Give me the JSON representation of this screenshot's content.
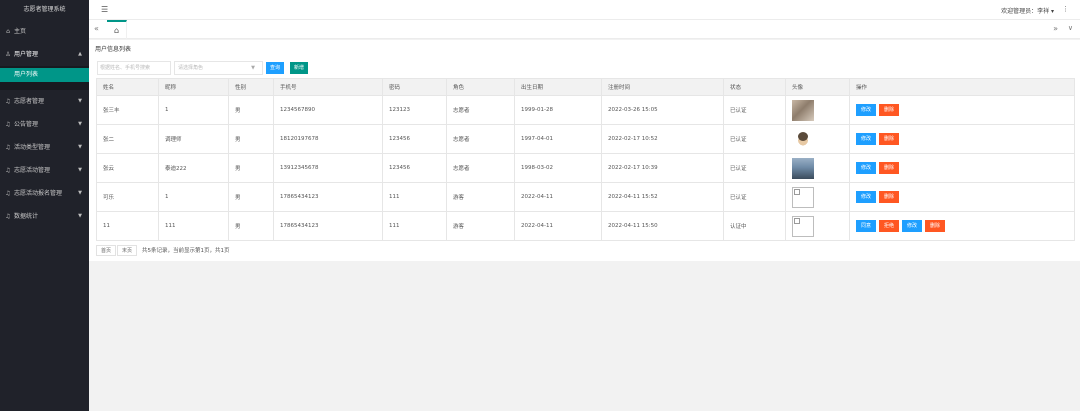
{
  "app": {
    "title": "志愿者管理系统"
  },
  "sidebar": {
    "items": [
      {
        "label": "主页",
        "icon": "home-icon"
      },
      {
        "label": "用户管理",
        "icon": "user-icon",
        "expanded": true,
        "children": [
          {
            "label": "用户列表",
            "active": true
          }
        ]
      },
      {
        "label": "志愿者管理",
        "icon": "bell-icon"
      },
      {
        "label": "公告管理",
        "icon": "bell-icon"
      },
      {
        "label": "活动类型管理",
        "icon": "bell-icon"
      },
      {
        "label": "志愿活动管理",
        "icon": "bell-icon"
      },
      {
        "label": "志愿活动报名管理",
        "icon": "bell-icon"
      },
      {
        "label": "数据统计",
        "icon": "bell-icon"
      }
    ]
  },
  "header": {
    "user_greeting": "欢迎管理员：李祥 ▾",
    "menu_icon": "hamburger-icon",
    "more_icon": "more-vertical-icon"
  },
  "tabs": {
    "prev": "«",
    "home_icon": "home-icon",
    "next": "»",
    "dropdown": "∨"
  },
  "page": {
    "title": "用户信息列表",
    "search_placeholder": "根据姓名、手机号搜索",
    "select_placeholder": "请选择角色",
    "btn_search": "查询",
    "btn_add": "新增"
  },
  "table": {
    "headers": [
      "姓名",
      "昵称",
      "性别",
      "手机号",
      "密码",
      "角色",
      "出生日期",
      "注册时间",
      "状态",
      "头像",
      "操作"
    ],
    "rows": [
      {
        "name": "张三丰",
        "nickname": "1",
        "gender": "男",
        "phone": "1234567890",
        "password": "123123",
        "role": "志愿者",
        "birth": "1999-01-28",
        "reg": "2022-03-26 15:05",
        "status": "已认证",
        "status_type": "ok",
        "avatar": "a1",
        "ops": [
          "修改",
          "删除"
        ]
      },
      {
        "name": "张二",
        "nickname": "调理师",
        "gender": "男",
        "phone": "18120197678",
        "password": "123456",
        "role": "志愿者",
        "birth": "1997-04-01",
        "reg": "2022-02-17 10:52",
        "status": "已认证",
        "status_type": "ok",
        "avatar": "a2",
        "ops": [
          "修改",
          "删除"
        ]
      },
      {
        "name": "张云",
        "nickname": "泰迪222",
        "gender": "男",
        "phone": "13912345678",
        "password": "123456",
        "role": "志愿者",
        "birth": "1998-03-02",
        "reg": "2022-02-17 10:39",
        "status": "已认证",
        "status_type": "ok",
        "avatar": "a3",
        "ops": [
          "修改",
          "删除"
        ]
      },
      {
        "name": "可乐",
        "nickname": "1",
        "gender": "男",
        "phone": "17865434123",
        "password": "111",
        "role": "游客",
        "birth": "2022-04-11",
        "reg": "2022-04-11 15:52",
        "status": "已认证",
        "status_type": "ok",
        "avatar": "broken",
        "ops": [
          "修改",
          "删除"
        ]
      },
      {
        "name": "11",
        "nickname": "111",
        "gender": "男",
        "phone": "17865434123",
        "password": "111",
        "role": "游客",
        "birth": "2022-04-11",
        "reg": "2022-04-11 15:50",
        "status": "认证中",
        "status_type": "pending",
        "avatar": "broken",
        "ops": [
          "同意",
          "拒绝",
          "修改",
          "删除"
        ]
      }
    ]
  },
  "pager": {
    "first": "首页",
    "last": "末页",
    "info": "共5条记录，当前显示第1页，共1页"
  },
  "colors": {
    "sidebar_bg": "#20222a",
    "accent": "#009688",
    "primary": "#1e9fff",
    "danger": "#ff5722"
  }
}
